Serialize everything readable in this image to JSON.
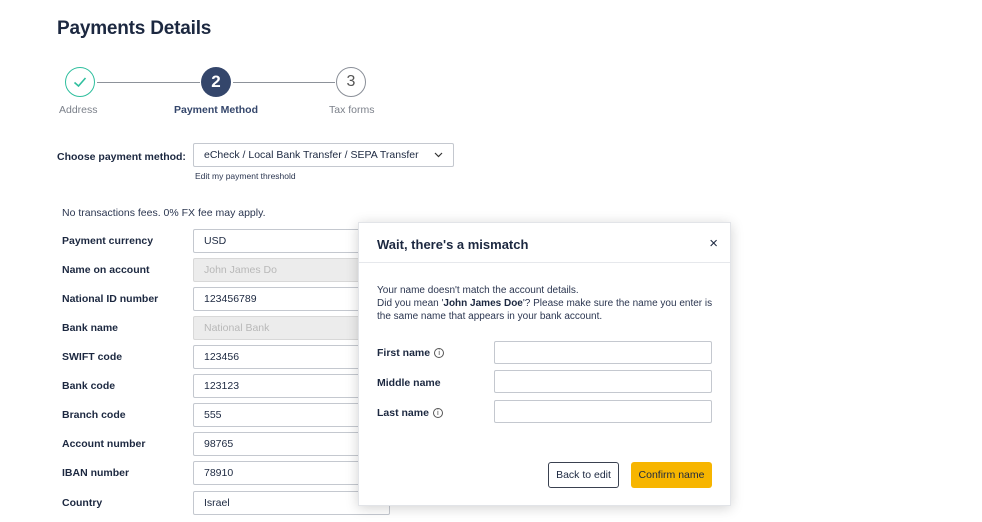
{
  "page": {
    "title": "Payments Details"
  },
  "stepper": {
    "steps": [
      {
        "number": "✓",
        "label": "Address",
        "state": "done"
      },
      {
        "number": "2",
        "label": "Payment Method",
        "state": "active"
      },
      {
        "number": "3",
        "label": "Tax forms",
        "state": "pending"
      }
    ],
    "colors": {
      "done": "#2fbf9e",
      "active": "#34466b"
    }
  },
  "payment_method": {
    "label": "Choose payment method:",
    "selected": "eCheck / Local Bank Transfer / SEPA Transfer",
    "threshold_link": "Edit my payment threshold"
  },
  "fee_note": "No transactions fees. 0% FX fee may apply.",
  "form": {
    "fields": [
      {
        "label": "Payment currency",
        "value": "USD"
      },
      {
        "label": "Name on account",
        "value": "John James Do",
        "disabled": true
      },
      {
        "label": "National ID number",
        "value": "123456789"
      },
      {
        "label": "Bank name",
        "value": "National Bank",
        "disabled": true
      },
      {
        "label": "SWIFT code",
        "value": "123456"
      },
      {
        "label": "Bank code",
        "value": "123123"
      },
      {
        "label": "Branch code",
        "value": "555"
      },
      {
        "label": "Account number",
        "value": "98765"
      },
      {
        "label": "IBAN number",
        "value": "78910"
      },
      {
        "label": "Country",
        "value": "Israel"
      }
    ]
  },
  "modal": {
    "title": "Wait, there's a mismatch",
    "close_icon": "×",
    "message_line1": "Your name doesn't match the account details.",
    "message_pre": "Did you mean '",
    "suggested_name": "John James Doe",
    "message_post": "'? Please make sure the name you enter is the same name that appears in your bank account.",
    "fields": [
      {
        "label": "First name",
        "has_info": true,
        "value": ""
      },
      {
        "label": "Middle name",
        "has_info": false,
        "value": ""
      },
      {
        "label": "Last name",
        "has_info": true,
        "value": ""
      }
    ],
    "info_glyph": "i",
    "back_label": "Back to edit",
    "confirm_label": "Confirm name",
    "confirm_color": "#f7b500"
  }
}
